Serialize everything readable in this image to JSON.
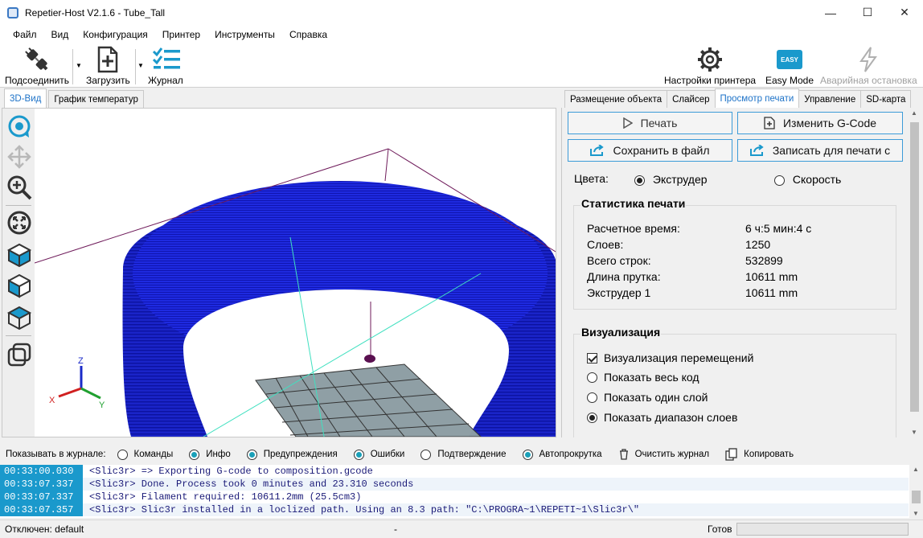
{
  "window": {
    "title": "Repetier-Host V2.1.6 - Tube_Tall",
    "minimize": "—",
    "maximize": "☐",
    "close": "✕"
  },
  "menu": [
    "Файл",
    "Вид",
    "Конфигурация",
    "Принтер",
    "Инструменты",
    "Справка"
  ],
  "toolbar": {
    "connect": "Подсоединить",
    "load": "Загрузить",
    "log": "Журнал",
    "printer_settings": "Настройки принтера",
    "easy_mode": "Easy Mode",
    "easy_badge": "EASY",
    "emergency": "Аварийная остановка"
  },
  "left_tabs": [
    "3D-Вид",
    "График температур"
  ],
  "right_tabs": [
    "Размещение объекта",
    "Слайсер",
    "Просмотр печати",
    "Управление",
    "SD-карта"
  ],
  "preview": {
    "print_btn": "Печать",
    "edit_gcode_btn": "Изменить G-Code",
    "save_btn": "Сохранить в файл",
    "write_btn": "Записать для печати с",
    "colors_label": "Цвета:",
    "color_extruder": "Экструдер",
    "color_speed": "Скорость",
    "stats_title": "Статистика печати",
    "stats": [
      {
        "label": "Расчетное время:",
        "value": "6 ч:5 мин:4 с"
      },
      {
        "label": "Слоев:",
        "value": "1250"
      },
      {
        "label": "Всего строк:",
        "value": "532899"
      },
      {
        "label": "Длина прутка:",
        "value": "10611 mm"
      },
      {
        "label": "Экструдер 1",
        "value": "10611 mm"
      }
    ],
    "vis_title": "Визуализация",
    "vis_travel": "Визуализация перемещений",
    "vis_all": "Показать весь код",
    "vis_one": "Показать один слой",
    "vis_range": "Показать диапазон слоев"
  },
  "log_options": {
    "label": "Показывать в журнале:",
    "commands": "Команды",
    "info": "Инфо",
    "warnings": "Предупреждения",
    "errors": "Ошибки",
    "ack": "Подтверждение",
    "autoscroll": "Автопрокрутка",
    "clear": "Очистить журнал",
    "copy": "Копировать"
  },
  "log": [
    {
      "time": "00:33:00.030",
      "msg": "<Slic3r> => Exporting G-code to composition.gcode"
    },
    {
      "time": "00:33:07.337",
      "msg": "<Slic3r> Done. Process took 0 minutes and 23.310 seconds"
    },
    {
      "time": "00:33:07.337",
      "msg": "<Slic3r> Filament required: 10611.2mm (25.5cm3)"
    },
    {
      "time": "00:33:07.357",
      "msg": "<Slic3r> Slic3r installed in a loclized path. Using an 8.3 path: \"C:\\PROGRA~1\\REPETI~1\\Slic3r\\\""
    }
  ],
  "status": {
    "connection": "Отключен: default",
    "middle": "-",
    "state": "Готов"
  },
  "axes": {
    "z": "Z",
    "x": "X",
    "y": "Y"
  }
}
